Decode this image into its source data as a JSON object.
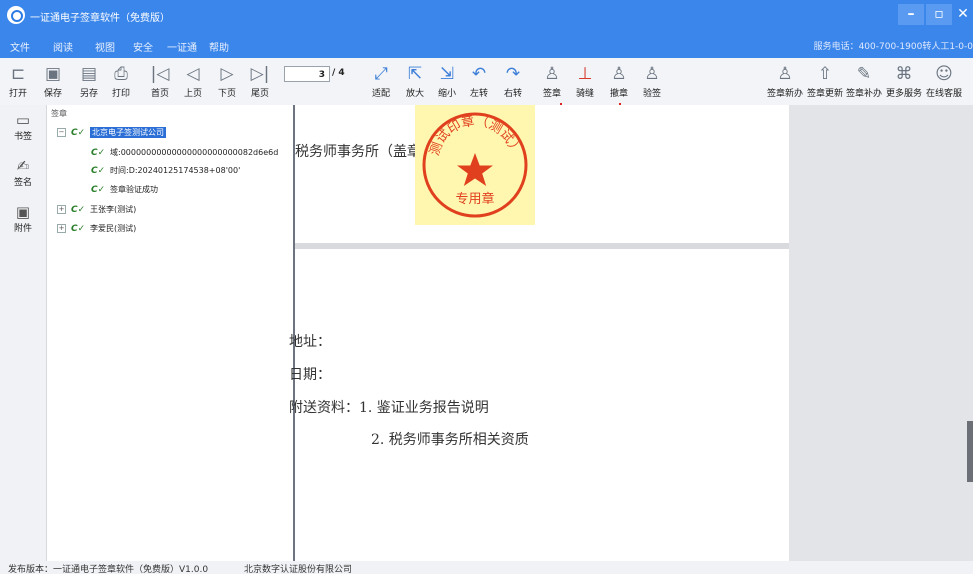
{
  "window": {
    "title": "一证通电子签章软件（免费版）"
  },
  "menu": {
    "items": [
      "文件",
      "阅读",
      "视图",
      "安全",
      "一证通",
      "帮助"
    ],
    "hotline": "服务电话：400-700-1900转人工1-0-0"
  },
  "toolbar": {
    "file": [
      {
        "name": "open",
        "label": "打开",
        "icon": "📂"
      },
      {
        "name": "save",
        "label": "保存",
        "icon": "💾"
      },
      {
        "name": "saveas",
        "label": "另存",
        "icon": "🗎"
      },
      {
        "name": "print",
        "label": "打印",
        "icon": "🖶"
      }
    ],
    "nav": [
      {
        "name": "first",
        "label": "首页",
        "icon": "|◁"
      },
      {
        "name": "prev",
        "label": "上页",
        "icon": "◁"
      },
      {
        "name": "next",
        "label": "下页",
        "icon": "▷"
      },
      {
        "name": "last",
        "label": "尾页",
        "icon": "▷|"
      }
    ],
    "page_current": "3",
    "page_total": "/ 4",
    "view": [
      {
        "name": "fit",
        "label": "适配",
        "icon": "⤢"
      },
      {
        "name": "zoom-in",
        "label": "放大",
        "icon": "⤡"
      },
      {
        "name": "zoom-out",
        "label": "缩小",
        "icon": "⤣"
      },
      {
        "name": "rotate-left",
        "label": "左转",
        "icon": "↶"
      },
      {
        "name": "rotate-right",
        "label": "右转",
        "icon": "↷"
      }
    ],
    "sign": [
      {
        "name": "sign",
        "label": "签章",
        "icon": "♙"
      },
      {
        "name": "seam-sign",
        "label": "骑缝",
        "icon": "⚲"
      },
      {
        "name": "revoke",
        "label": "撤章",
        "icon": "♙"
      },
      {
        "name": "verify",
        "label": "验签",
        "icon": "♙"
      }
    ],
    "services": [
      {
        "name": "new-seal",
        "label": "签章新办",
        "icon": "♙"
      },
      {
        "name": "update-seal",
        "label": "签章更新",
        "icon": "⇧"
      },
      {
        "name": "reissue-seal",
        "label": "签章补办",
        "icon": "✎"
      },
      {
        "name": "more-services",
        "label": "更多服务",
        "icon": "⌘"
      },
      {
        "name": "online-support",
        "label": "在线客服",
        "icon": "☺"
      }
    ]
  },
  "sidebar": {
    "items": [
      {
        "name": "bookmark",
        "label": "书签",
        "icon": "🔖"
      },
      {
        "name": "signature",
        "label": "签名",
        "icon": "✍"
      },
      {
        "name": "attachment",
        "label": "附件",
        "icon": "📎"
      }
    ]
  },
  "tree": {
    "header": "签章",
    "root": "北京电子签测试公司",
    "details": [
      "域:00000000000000000000000082d6e6d",
      "时间:D:20240125174538+08'00'",
      "签章验证成功"
    ],
    "siblings": [
      "王张李(测试)",
      "李爱民(测试)"
    ]
  },
  "document": {
    "page1_line": "税务师事务所（盖章）",
    "lines": [
      "地址：",
      "日期：",
      "附送资料：1. 鉴证业务报告说明",
      "2. 税务师事务所相关资质"
    ]
  },
  "seal": {
    "text_top": "测试印章（测试）",
    "text_bottom": "专用章"
  },
  "status": {
    "version": "发布版本：一证通电子签章软件（免费版）V1.0.0",
    "company": "北京数字认证股份有限公司"
  }
}
